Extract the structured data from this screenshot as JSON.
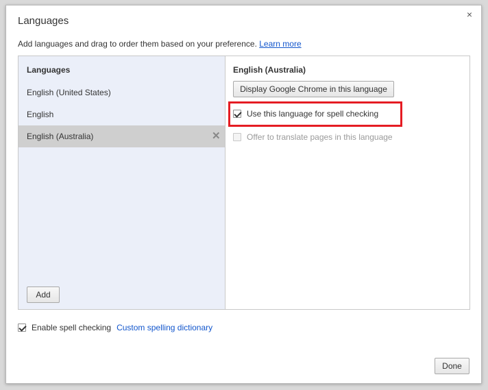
{
  "dialog": {
    "title": "Languages",
    "close_glyph": "×",
    "description": "Add languages and drag to order them based on your preference.",
    "learn_more": "Learn more"
  },
  "left_panel": {
    "heading": "Languages",
    "items": [
      {
        "label": "English (United States)",
        "selected": false
      },
      {
        "label": "English",
        "selected": false
      },
      {
        "label": "English (Australia)",
        "selected": true
      }
    ],
    "remove_glyph": "✕",
    "add_button": "Add"
  },
  "right_panel": {
    "heading": "English (Australia)",
    "display_button": "Display Google Chrome in this language",
    "spell_check_label": "Use this language for spell checking",
    "spell_check_checked": true,
    "translate_label": "Offer to translate pages in this language",
    "translate_checked": false,
    "translate_disabled": true
  },
  "footer": {
    "enable_spell_label": "Enable spell checking",
    "enable_spell_checked": true,
    "custom_dictionary_link": "Custom spelling dictionary",
    "done_button": "Done"
  },
  "colors": {
    "highlight": "#e51c23",
    "left_panel_bg": "#ebeff9",
    "selected_row_bg": "#cfcfcf",
    "link": "#1155cc"
  }
}
